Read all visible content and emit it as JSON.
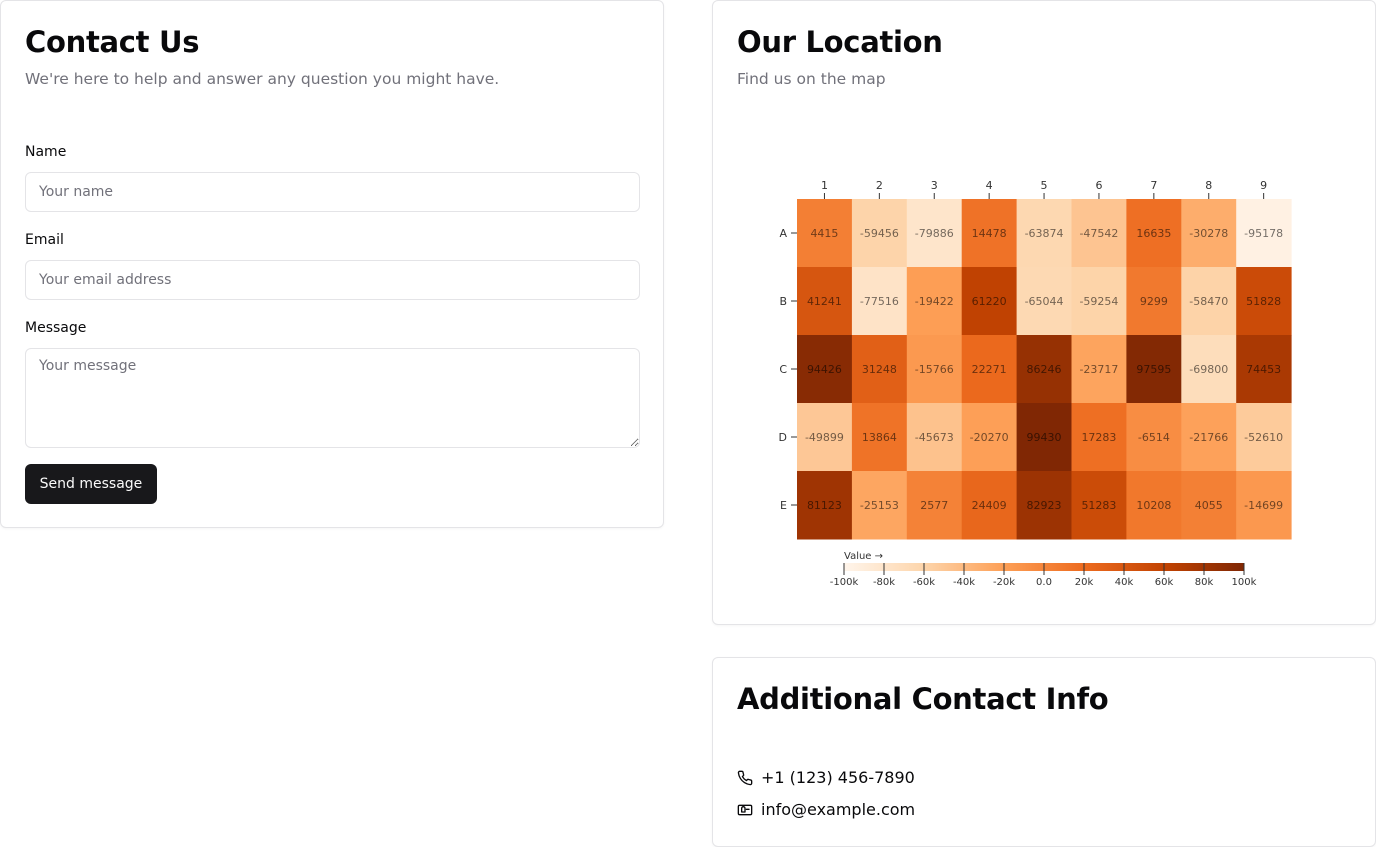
{
  "contact": {
    "title": "Contact Us",
    "subtitle": "We're here to help and answer any question you might have.",
    "name_label": "Name",
    "name_placeholder": "Your name",
    "email_label": "Email",
    "email_placeholder": "Your email address",
    "message_label": "Message",
    "message_placeholder": "Your message",
    "submit_label": "Send message"
  },
  "location": {
    "title": "Our Location",
    "subtitle": "Find us on the map"
  },
  "additional": {
    "title": "Additional Contact Info",
    "phone": "+1 (123) 456-7890",
    "phone_icon": "phone-icon",
    "email": "info@example.com",
    "email_icon": "mail-icon"
  },
  "chart_data": {
    "type": "heatmap",
    "columns": [
      "1",
      "2",
      "3",
      "4",
      "5",
      "6",
      "7",
      "8",
      "9"
    ],
    "rows": [
      "A",
      "B",
      "C",
      "D",
      "E"
    ],
    "values": [
      [
        4415,
        -59456,
        -79886,
        14478,
        -63874,
        -47542,
        16635,
        -30278,
        -95178
      ],
      [
        41241,
        -77516,
        -19422,
        61220,
        -65044,
        -59254,
        9299,
        -58470,
        51828
      ],
      [
        94426,
        31248,
        -15766,
        22271,
        86246,
        -23717,
        97595,
        -69800,
        74453
      ],
      [
        -49899,
        13864,
        -45673,
        -20270,
        99430,
        17283,
        -6514,
        -21766,
        -52610
      ],
      [
        81123,
        -25153,
        2577,
        24409,
        82923,
        51283,
        10208,
        4055,
        -14699
      ]
    ],
    "legend": {
      "title": "Value →",
      "domain": [
        -100000,
        100000
      ],
      "ticks": [
        "-100k",
        "-80k",
        "-60k",
        "-40k",
        "-20k",
        "0.0",
        "20k",
        "40k",
        "60k",
        "80k",
        "100k"
      ]
    },
    "color_scheme": "oranges",
    "colors": [
      "#fff5eb",
      "#fdd5ab",
      "#fd9f56",
      "#ed6b1f",
      "#c24302",
      "#7f2704"
    ]
  }
}
